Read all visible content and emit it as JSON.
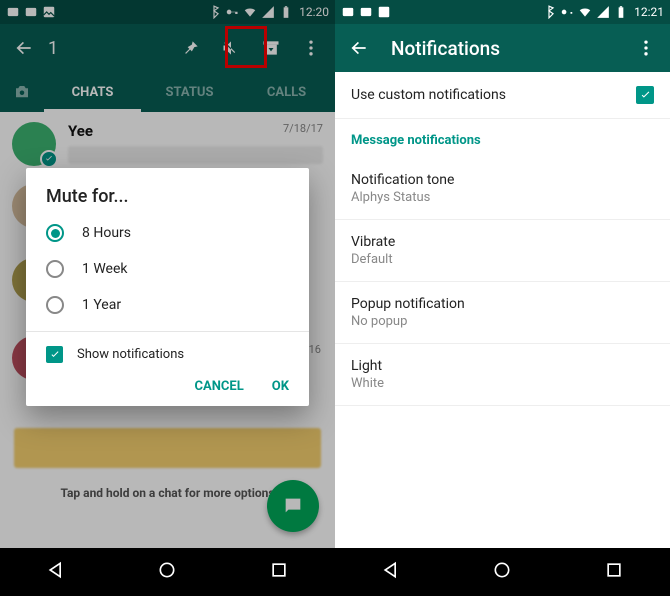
{
  "left": {
    "status_time": "12:20",
    "selection_count": "1",
    "tabs": {
      "chats": "CHATS",
      "status": "STATUS",
      "calls": "CALLS"
    },
    "chat": {
      "name": "Yee",
      "date": "7/18/17"
    },
    "row2_date": "16",
    "hint": "Tap and hold on a chat for more options",
    "dialog": {
      "title": "Mute for...",
      "opt1": "8 Hours",
      "opt2": "1 Week",
      "opt3": "1 Year",
      "show_notifs": "Show notifications",
      "cancel": "CANCEL",
      "ok": "OK"
    }
  },
  "right": {
    "status_time": "12:21",
    "title": "Notifications",
    "custom": "Use custom notifications",
    "section_msg": "Message notifications",
    "tone_lbl": "Notification tone",
    "tone_val": "Alphys Status",
    "vibrate_lbl": "Vibrate",
    "vibrate_val": "Default",
    "popup_lbl": "Popup notification",
    "popup_val": "No popup",
    "light_lbl": "Light",
    "light_val": "White"
  }
}
